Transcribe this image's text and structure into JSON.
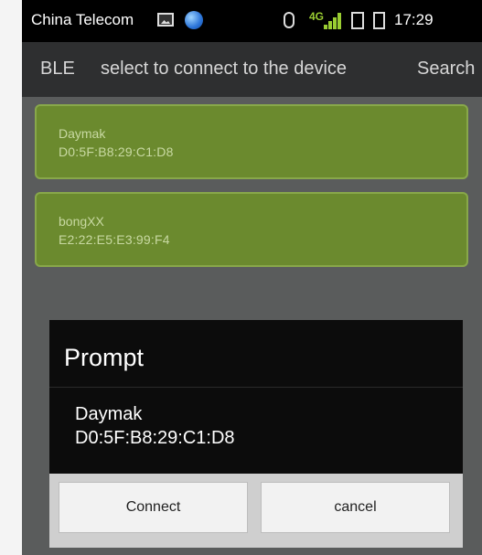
{
  "status_bar": {
    "carrier": "China Telecom",
    "network_type": "4G",
    "time": "17:29",
    "icons": [
      "image-icon",
      "globe-icon",
      "bluetooth-icon",
      "signal-icon",
      "sim-icon",
      "battery-icon"
    ]
  },
  "action_bar": {
    "app_label": "BLE",
    "title": "select to connect to the device",
    "search_label": "Search"
  },
  "devices": [
    {
      "name": "Daymak",
      "address": "D0:5F:B8:29:C1:D8"
    },
    {
      "name": "bongXX",
      "address": "E2:22:E5:E3:99:F4"
    }
  ],
  "dialog": {
    "title": "Prompt",
    "device_name": "Daymak",
    "device_address": "D0:5F:B8:29:C1:D8",
    "connect_label": "Connect",
    "cancel_label": "cancel"
  },
  "colors": {
    "device_card": "#6b8a2e",
    "action_bar": "#2e2f30",
    "dialog_bg": "#0c0c0c",
    "network_badge": "#9acd32"
  }
}
